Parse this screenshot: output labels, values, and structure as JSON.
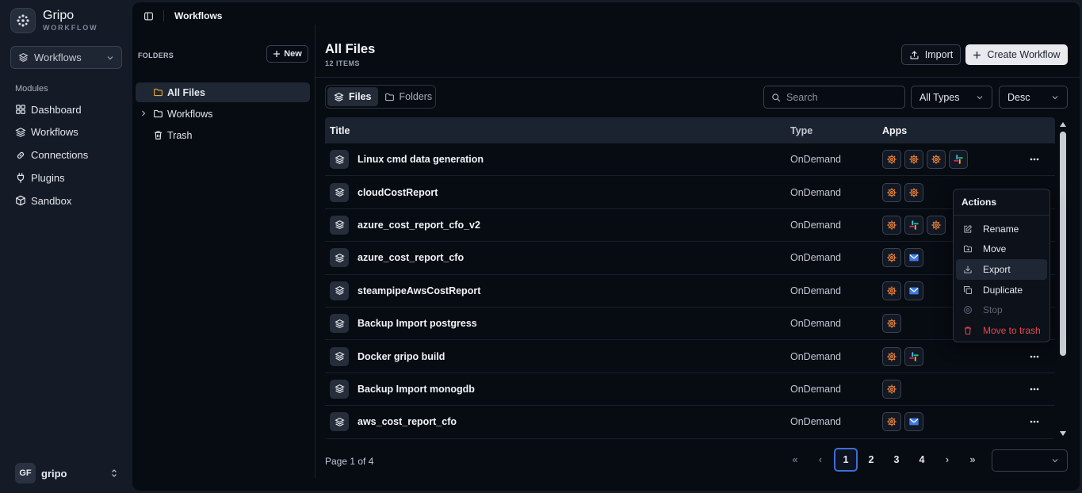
{
  "brand": {
    "name": "Gripo",
    "sub": "WORKFLOW"
  },
  "workspace_select": {
    "value": "Workflows"
  },
  "sidebar": {
    "modules_title": "Modules",
    "items": [
      {
        "label": "Dashboard",
        "icon": "grid-icon"
      },
      {
        "label": "Workflows",
        "icon": "layers-icon"
      },
      {
        "label": "Connections",
        "icon": "link-icon"
      },
      {
        "label": "Plugins",
        "icon": "plug-icon"
      },
      {
        "label": "Sandbox",
        "icon": "box-icon"
      }
    ]
  },
  "user": {
    "initials": "GF",
    "name": "gripo"
  },
  "topbar": {
    "title": "Workflows"
  },
  "folders": {
    "header": "FOLDERS",
    "new_label": "New",
    "items": [
      {
        "label": "All Files",
        "active": true
      },
      {
        "label": "Workflows",
        "active": false
      },
      {
        "label": "Trash",
        "active": false
      }
    ]
  },
  "content": {
    "title": "All Files",
    "count": "12 ITEMS",
    "import_label": "Import",
    "create_label": "Create Workflow",
    "tabs": [
      {
        "label": "Files"
      },
      {
        "label": "Folders"
      }
    ],
    "search_placeholder": "Search",
    "type_filter": "All Types",
    "sort": "Desc"
  },
  "table": {
    "columns": [
      "Title",
      "Type",
      "Apps"
    ],
    "rows": [
      {
        "title": "Linux cmd data generation",
        "type": "OnDemand",
        "apps": [
          "plugin",
          "plugin",
          "plugin",
          "slack"
        ],
        "menu": true
      },
      {
        "title": "cloudCostReport",
        "type": "OnDemand",
        "apps": [
          "plugin",
          "plugin"
        ],
        "menu": false
      },
      {
        "title": "azure_cost_report_cfo_v2",
        "type": "OnDemand",
        "apps": [
          "plugin",
          "slack",
          "plugin"
        ],
        "menu": false
      },
      {
        "title": "azure_cost_report_cfo",
        "type": "OnDemand",
        "apps": [
          "plugin",
          "email"
        ],
        "menu": false
      },
      {
        "title": "steampipeAwsCostReport",
        "type": "OnDemand",
        "apps": [
          "plugin",
          "email"
        ],
        "menu": false
      },
      {
        "title": "Backup Import postgress",
        "type": "OnDemand",
        "apps": [
          "plugin"
        ],
        "menu": false
      },
      {
        "title": "Docker gripo build",
        "type": "OnDemand",
        "apps": [
          "plugin",
          "slack"
        ],
        "menu": true
      },
      {
        "title": "Backup Import monogdb",
        "type": "OnDemand",
        "apps": [
          "plugin"
        ],
        "menu": true
      },
      {
        "title": "aws_cost_report_cfo",
        "type": "OnDemand",
        "apps": [
          "plugin",
          "email"
        ],
        "menu": true
      }
    ]
  },
  "pagination": {
    "info": "Page 1 of 4",
    "pages": [
      "1",
      "2",
      "3",
      "4"
    ],
    "current": "1",
    "arrows": {
      "first": "«",
      "prev": "‹",
      "next": "›",
      "last": "»"
    }
  },
  "actions_menu": {
    "title": "Actions",
    "items": [
      {
        "label": "Rename",
        "icon": "edit-icon",
        "state": "normal"
      },
      {
        "label": "Move",
        "icon": "folder-move-icon",
        "state": "normal"
      },
      {
        "label": "Export",
        "icon": "download-icon",
        "state": "highlighted"
      },
      {
        "label": "Duplicate",
        "icon": "copy-icon",
        "state": "normal"
      },
      {
        "label": "Stop",
        "icon": "stop-circle-icon",
        "state": "disabled"
      },
      {
        "label": "Move to trash",
        "icon": "trash-icon",
        "state": "danger"
      }
    ]
  },
  "colors": {
    "accent_blue": "#3b6fd4",
    "danger": "#e5484d",
    "plugin_orange": "#e8823a",
    "folder_yellow": "#e9a63a"
  }
}
